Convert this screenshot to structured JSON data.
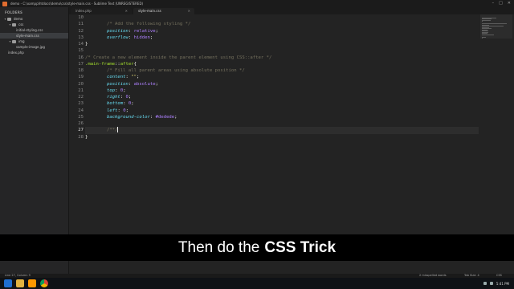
{
  "window": {
    "title": "demo - C:\\xampp\\htdocs\\demo\\css\\style-main.css - Sublime Text (UNREGISTERED)"
  },
  "window_buttons": [
    "–",
    "□",
    "✕"
  ],
  "sidebar": {
    "heading": "FOLDERS",
    "items": [
      {
        "label": "demo",
        "depth": 1,
        "type": "folder",
        "open": true
      },
      {
        "label": "css",
        "depth": 2,
        "type": "folder",
        "open": true
      },
      {
        "label": "initial-styling.css",
        "depth": 3,
        "type": "file"
      },
      {
        "label": "style-main.css",
        "depth": 3,
        "type": "file",
        "active": true
      },
      {
        "label": "img",
        "depth": 2,
        "type": "folder",
        "open": true
      },
      {
        "label": "sample-image.jpg",
        "depth": 3,
        "type": "file"
      },
      {
        "label": "index.php",
        "depth": 2,
        "type": "file"
      }
    ]
  },
  "tabs": [
    {
      "label": "index.php",
      "active": false
    },
    {
      "label": "style-main.css",
      "active": true
    }
  ],
  "editor": {
    "current_line": 27,
    "lines": [
      {
        "n": 10,
        "tokens": []
      },
      {
        "n": 11,
        "tokens": [
          {
            "t": "        ",
            "c": ""
          },
          {
            "t": "/* Add the following styling */",
            "c": "comment"
          }
        ]
      },
      {
        "n": 12,
        "tokens": [
          {
            "t": "        ",
            "c": ""
          },
          {
            "t": "position",
            "c": "prop"
          },
          {
            "t": ": ",
            "c": "punct"
          },
          {
            "t": "relative",
            "c": "value"
          },
          {
            "t": ";",
            "c": "punct"
          }
        ]
      },
      {
        "n": 13,
        "tokens": [
          {
            "t": "        ",
            "c": ""
          },
          {
            "t": "overflow",
            "c": "prop"
          },
          {
            "t": ": ",
            "c": "punct"
          },
          {
            "t": "hidden",
            "c": "value"
          },
          {
            "t": ";",
            "c": "punct"
          }
        ]
      },
      {
        "n": 14,
        "tokens": [
          {
            "t": "}",
            "c": "punct"
          }
        ]
      },
      {
        "n": 15,
        "tokens": []
      },
      {
        "n": 16,
        "tokens": [
          {
            "t": "/* Create a new element inside the parent element using CSS::after */",
            "c": "comment"
          }
        ]
      },
      {
        "n": 17,
        "tokens": [
          {
            "t": ".main-frame",
            "c": "selector"
          },
          {
            "t": "::",
            "c": "pseudo"
          },
          {
            "t": "after",
            "c": "selector"
          },
          {
            "t": "{",
            "c": "punct"
          }
        ]
      },
      {
        "n": 18,
        "tokens": [
          {
            "t": "        ",
            "c": ""
          },
          {
            "t": "/* Fill all parent areas using absolute position */",
            "c": "comment"
          }
        ]
      },
      {
        "n": 19,
        "tokens": [
          {
            "t": "        ",
            "c": ""
          },
          {
            "t": "content",
            "c": "prop"
          },
          {
            "t": ": ",
            "c": "punct"
          },
          {
            "t": "\"\"",
            "c": "string"
          },
          {
            "t": ";",
            "c": "punct"
          }
        ]
      },
      {
        "n": 20,
        "tokens": [
          {
            "t": "        ",
            "c": ""
          },
          {
            "t": "position",
            "c": "prop"
          },
          {
            "t": ": ",
            "c": "punct"
          },
          {
            "t": "absolute",
            "c": "value"
          },
          {
            "t": ";",
            "c": "punct"
          }
        ]
      },
      {
        "n": 21,
        "tokens": [
          {
            "t": "        ",
            "c": ""
          },
          {
            "t": "top",
            "c": "prop"
          },
          {
            "t": ": ",
            "c": "punct"
          },
          {
            "t": "0",
            "c": "value"
          },
          {
            "t": ";",
            "c": "punct"
          }
        ]
      },
      {
        "n": 22,
        "tokens": [
          {
            "t": "        ",
            "c": ""
          },
          {
            "t": "right",
            "c": "prop"
          },
          {
            "t": ": ",
            "c": "punct"
          },
          {
            "t": "0",
            "c": "value"
          },
          {
            "t": ";",
            "c": "punct"
          }
        ]
      },
      {
        "n": 23,
        "tokens": [
          {
            "t": "        ",
            "c": ""
          },
          {
            "t": "bottom",
            "c": "prop"
          },
          {
            "t": ": ",
            "c": "punct"
          },
          {
            "t": "0",
            "c": "value"
          },
          {
            "t": ";",
            "c": "punct"
          }
        ]
      },
      {
        "n": 24,
        "tokens": [
          {
            "t": "        ",
            "c": ""
          },
          {
            "t": "left",
            "c": "prop"
          },
          {
            "t": ": ",
            "c": "punct"
          },
          {
            "t": "0",
            "c": "value"
          },
          {
            "t": ";",
            "c": "punct"
          }
        ]
      },
      {
        "n": 25,
        "tokens": [
          {
            "t": "        ",
            "c": ""
          },
          {
            "t": "background-color",
            "c": "prop"
          },
          {
            "t": ": ",
            "c": "punct"
          },
          {
            "t": "#dedede",
            "c": "value"
          },
          {
            "t": ";",
            "c": "punct"
          }
        ]
      },
      {
        "n": 26,
        "tokens": []
      },
      {
        "n": 27,
        "tokens": [
          {
            "t": "        ",
            "c": ""
          },
          {
            "t": "/**/",
            "c": "comment"
          }
        ]
      },
      {
        "n": 28,
        "tokens": [
          {
            "t": "}",
            "c": "punct"
          }
        ]
      }
    ]
  },
  "subtitle": {
    "prefix": "Then do the",
    "bold": "CSS Trick"
  },
  "statusbar": {
    "position": "Line 27, Column 9",
    "spell": "2 misspelled words",
    "tabsize": "Tab Size: 4",
    "syntax": "CSS"
  },
  "taskbar": {
    "icons": [
      "windows-start-icon",
      "file-explorer-icon",
      "sublime-text-icon",
      "chrome-icon"
    ],
    "clock": "5:41 PM"
  },
  "colors": {
    "comment": "#75715e",
    "prop": "#66d9ef",
    "value": "#ae81ff",
    "string": "#e6db74",
    "selector": "#a6e22e",
    "keyword": "#f92672"
  }
}
